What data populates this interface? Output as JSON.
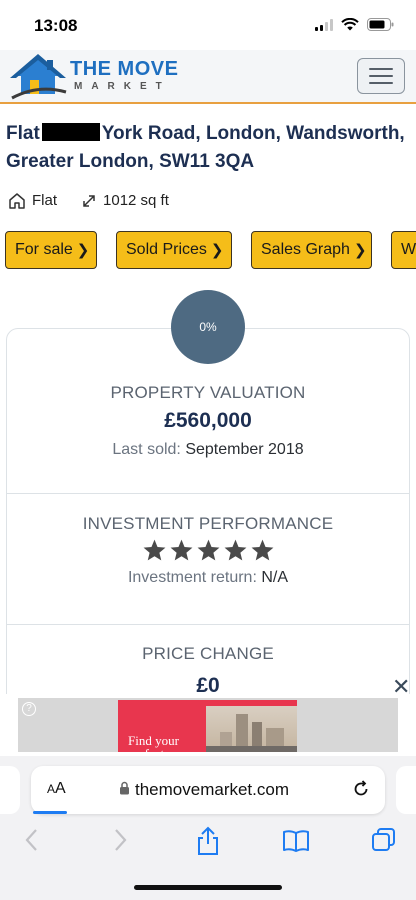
{
  "status_bar": {
    "time": "13:08"
  },
  "header": {
    "logo_title": "THE MOVE",
    "logo_subtitle": "MARKET",
    "menu_icon": "hamburger-icon"
  },
  "property": {
    "address_prefix": "Flat",
    "address_rest": "York Road, London, Wandsworth, Greater London, SW11 3QA",
    "type": "Flat",
    "size": "1012 sq ft"
  },
  "nav_buttons": [
    {
      "label": "For sale"
    },
    {
      "label": "Sold Prices"
    },
    {
      "label": "Sales Graph"
    },
    {
      "label": "W"
    }
  ],
  "card": {
    "percent": "0%",
    "valuation": {
      "title": "PROPERTY VALUATION",
      "value": "£560,000",
      "last_sold_label": "Last sold:",
      "last_sold_value": "September 2018"
    },
    "investment": {
      "title": "INVESTMENT PERFORMANCE",
      "stars": 5,
      "return_label": "Investment return:",
      "return_value": "N/A"
    },
    "price_change": {
      "title": "PRICE CHANGE",
      "value": "£0"
    }
  },
  "ad": {
    "text_line1": "Find your",
    "text_line2": "perfect"
  },
  "browser": {
    "aa_label": "AA",
    "url": "themovemarket.com"
  },
  "colors": {
    "accent_yellow": "#f5bd19",
    "brand_blue": "#1e6fc0",
    "navy": "#1d2f52",
    "circle": "#4e6a82"
  }
}
